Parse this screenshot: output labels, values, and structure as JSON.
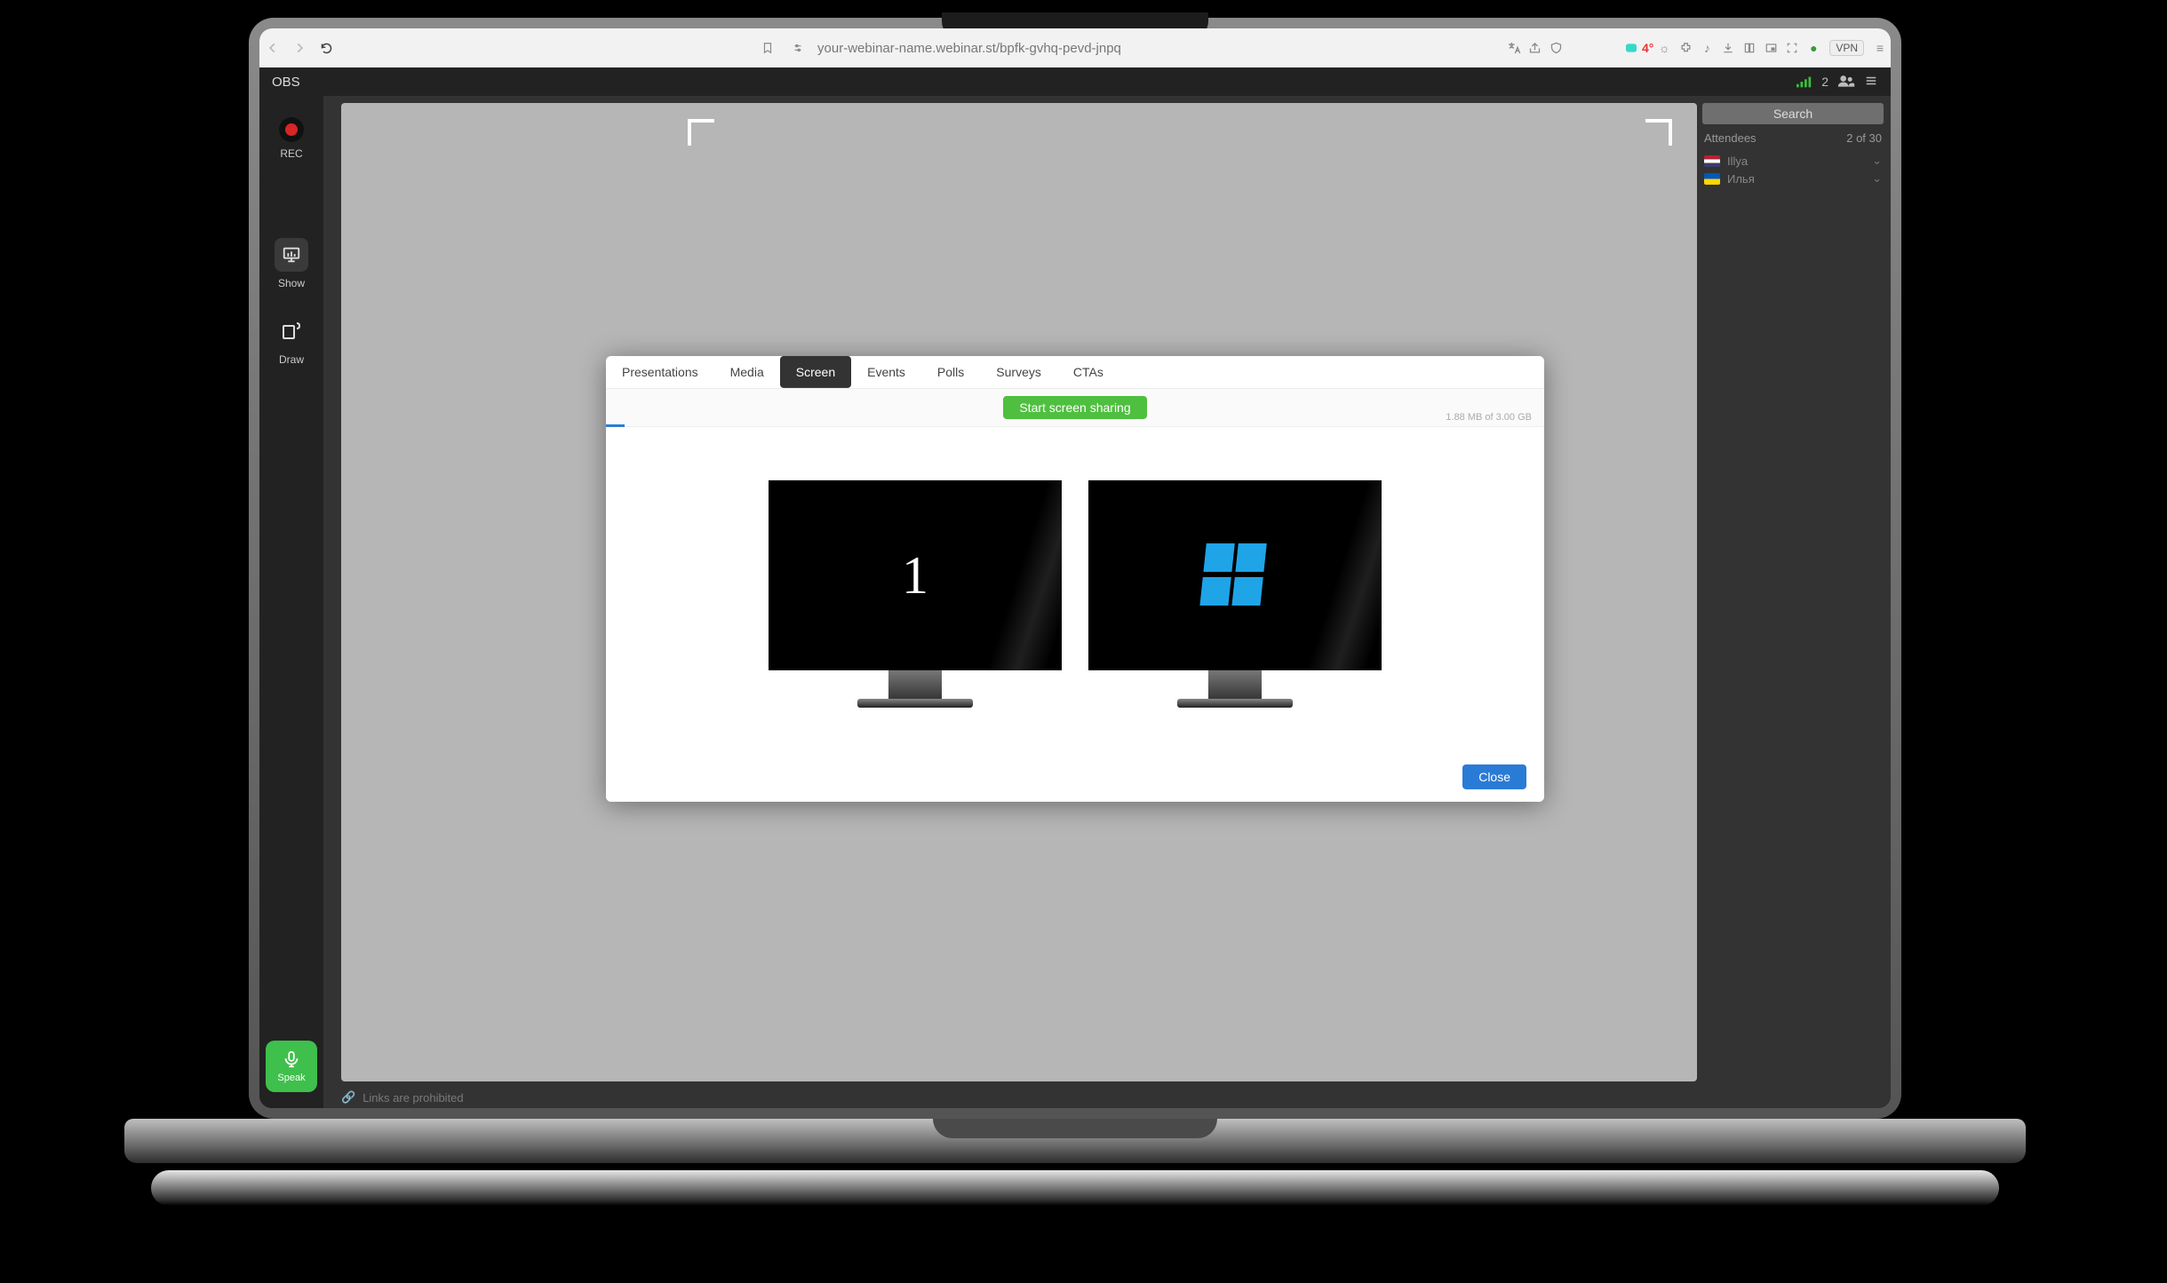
{
  "browser": {
    "url": "your-webinar-name.webinar.st/bpfk-gvhq-pevd-jnpq",
    "vpn": "VPN",
    "badge": "4°"
  },
  "app": {
    "title": "OBS",
    "participants": "2"
  },
  "rail": {
    "rec": "REC",
    "show": "Show",
    "draw": "Draw",
    "speak": "Speak"
  },
  "panel": {
    "search": "Search",
    "attendees_label": "Attendees",
    "attendees_count": "2 of 30",
    "items": [
      {
        "name": "Illya"
      },
      {
        "name": "Илья"
      }
    ]
  },
  "footer": {
    "links": "Links are prohibited"
  },
  "modal": {
    "tabs": [
      "Presentations",
      "Media",
      "Screen",
      "Events",
      "Polls",
      "Surveys",
      "CTAs"
    ],
    "active": 2,
    "share": "Start screen sharing",
    "quota": "1.88 MB of 3.00 GB",
    "screen1": "1",
    "close": "Close"
  }
}
